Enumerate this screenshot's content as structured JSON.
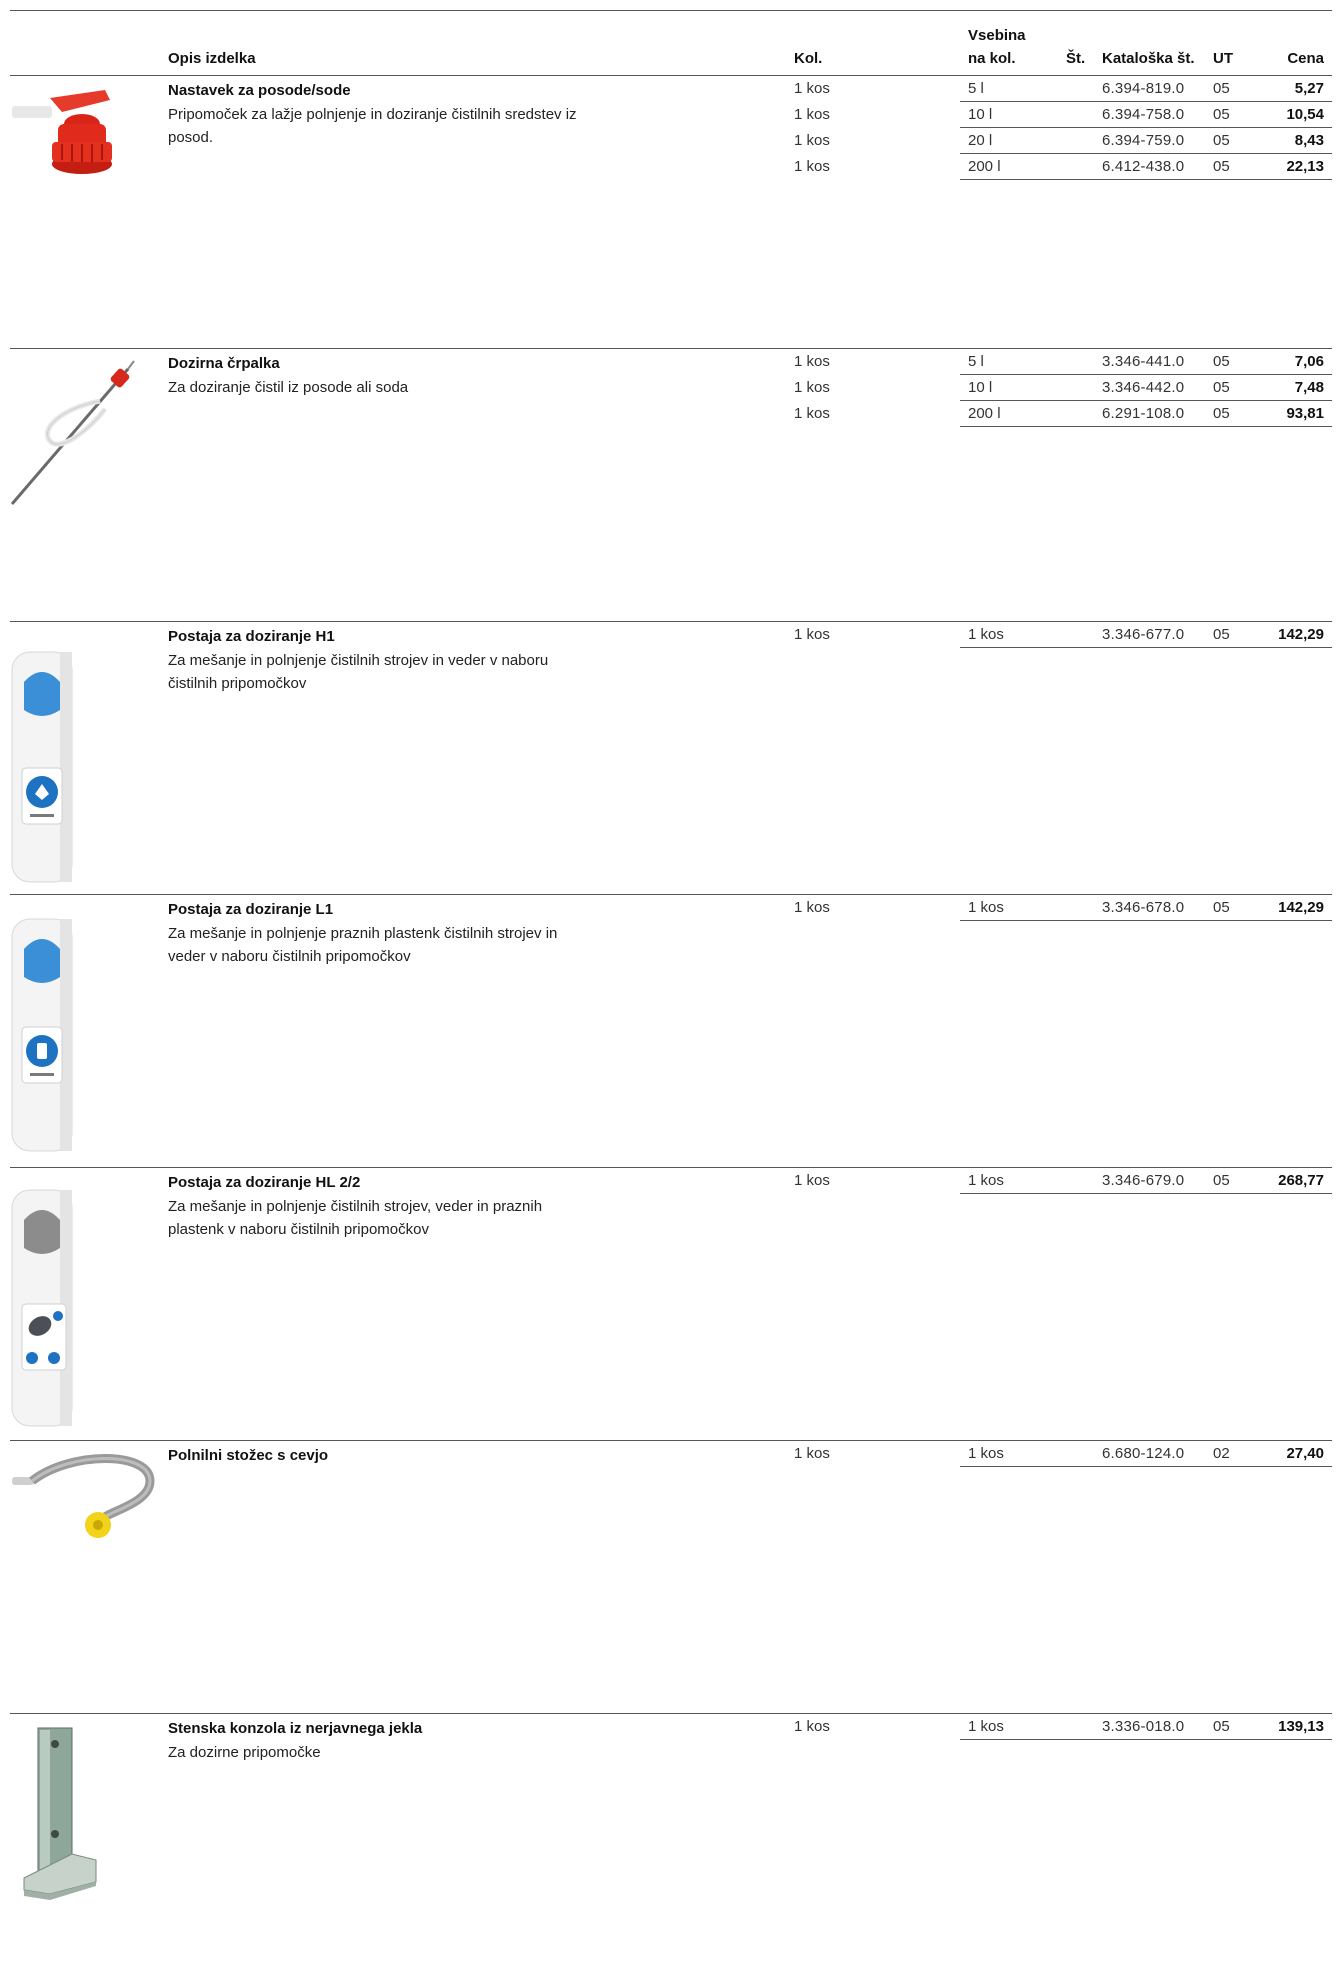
{
  "header": {
    "col_desc": "Opis izdelka",
    "col_qty": "Kol.",
    "col_content_1": "Vsebina",
    "col_content_2": "na kol.",
    "col_no": "Št.",
    "col_catalog": "Kataloška št.",
    "col_ut": "UT",
    "col_price": "Cena"
  },
  "products": [
    {
      "name": "Nastavek za posode/sode",
      "description": "Pripomoček za lažje polnjenje in doziranje čistilnih sredstev iz posod.",
      "image_icon": "red-canister-spout-icon",
      "rows": [
        {
          "qty": "1 kos",
          "content": "5 l",
          "catalog": "6.394-819.0",
          "ut": "05",
          "price": "5,27"
        },
        {
          "qty": "1 kos",
          "content": "10 l",
          "catalog": "6.394-758.0",
          "ut": "05",
          "price": "10,54"
        },
        {
          "qty": "1 kos",
          "content": "20 l",
          "catalog": "6.394-759.0",
          "ut": "05",
          "price": "8,43"
        },
        {
          "qty": "1 kos",
          "content": "200 l",
          "catalog": "6.412-438.0",
          "ut": "05",
          "price": "22,13"
        }
      ]
    },
    {
      "name": "Dozirna črpalka",
      "description": "Za doziranje čistil iz posode ali soda",
      "image_icon": "dosing-pump-icon",
      "rows": [
        {
          "qty": "1 kos",
          "content": "5 l",
          "catalog": "3.346-441.0",
          "ut": "05",
          "price": "7,06"
        },
        {
          "qty": "1 kos",
          "content": "10 l",
          "catalog": "3.346-442.0",
          "ut": "05",
          "price": "7,48"
        },
        {
          "qty": "1 kos",
          "content": "200 l",
          "catalog": "6.291-108.0",
          "ut": "05",
          "price": "93,81"
        }
      ]
    },
    {
      "name": "Postaja za doziranje H1",
      "description": "Za mešanje in polnjenje čistilnih strojev in veder v naboru čistilnih pripomočkov",
      "image_icon": "dosing-station-blue-icon",
      "rows": [
        {
          "qty": "1 kos",
          "content": "1 kos",
          "catalog": "3.346-677.0",
          "ut": "05",
          "price": "142,29"
        }
      ]
    },
    {
      "name": "Postaja za doziranje L1",
      "description": "Za mešanje in polnjenje praznih plastenk čistilnih strojev in veder v naboru čistilnih pripomočkov",
      "image_icon": "dosing-station-blue-icon",
      "rows": [
        {
          "qty": "1 kos",
          "content": "1 kos",
          "catalog": "3.346-678.0",
          "ut": "05",
          "price": "142,29"
        }
      ]
    },
    {
      "name": "Postaja za doziranje HL 2/2",
      "description": "Za mešanje in polnjenje čistilnih strojev, veder in praznih plastenk v naboru čistilnih pripomočkov",
      "image_icon": "dosing-station-grey-icon",
      "rows": [
        {
          "qty": "1 kos",
          "content": "1 kos",
          "catalog": "3.346-679.0",
          "ut": "05",
          "price": "268,77"
        }
      ]
    },
    {
      "name": "Polnilni stožec s cevjo",
      "description": "",
      "image_icon": "filling-cone-hose-icon",
      "rows": [
        {
          "qty": "1 kos",
          "content": "1 kos",
          "catalog": "6.680-124.0",
          "ut": "02",
          "price": "27,40"
        }
      ]
    },
    {
      "name": "Stenska konzola iz nerjavnega jekla",
      "description": "Za dozirne pripomočke",
      "image_icon": "steel-wall-bracket-icon",
      "rows": [
        {
          "qty": "1 kos",
          "content": "1 kos",
          "catalog": "3.336-018.0",
          "ut": "05",
          "price": "139,13"
        }
      ]
    }
  ]
}
